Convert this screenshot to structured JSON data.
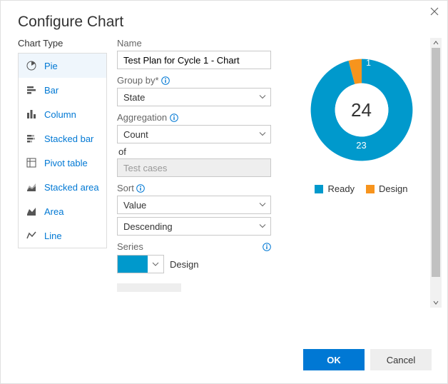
{
  "dialog": {
    "title": "Configure Chart"
  },
  "chart_type": {
    "label": "Chart Type",
    "items": [
      {
        "icon": "pie",
        "label": "Pie",
        "selected": true
      },
      {
        "icon": "bar",
        "label": "Bar",
        "selected": false
      },
      {
        "icon": "column",
        "label": "Column",
        "selected": false
      },
      {
        "icon": "stacked-bar",
        "label": "Stacked bar",
        "selected": false
      },
      {
        "icon": "pivot",
        "label": "Pivot table",
        "selected": false
      },
      {
        "icon": "stacked-area",
        "label": "Stacked area",
        "selected": false
      },
      {
        "icon": "area",
        "label": "Area",
        "selected": false
      },
      {
        "icon": "line",
        "label": "Line",
        "selected": false
      }
    ]
  },
  "form": {
    "name_label": "Name",
    "name_value": "Test Plan for Cycle 1 - Chart",
    "group_by_label": "Group by*",
    "group_by_value": "State",
    "aggregation_label": "Aggregation",
    "aggregation_value": "Count",
    "of_label": "of",
    "of_value": "Test cases",
    "sort_label": "Sort",
    "sort_field": "Value",
    "sort_dir": "Descending",
    "series_label": "Series",
    "series_current": "Design",
    "series_color": "#0099cc"
  },
  "preview": {
    "total": "24",
    "legend": [
      {
        "name": "Ready",
        "color": "#0099cc"
      },
      {
        "name": "Design",
        "color": "#f7941d"
      }
    ]
  },
  "buttons": {
    "ok": "OK",
    "cancel": "Cancel"
  },
  "chart_data": {
    "type": "pie",
    "title": "Test Plan for Cycle 1 - Chart",
    "categories": [
      "Ready",
      "Design"
    ],
    "values": [
      23,
      1
    ],
    "total": 24,
    "colors": [
      "#0099cc",
      "#f7941d"
    ]
  }
}
